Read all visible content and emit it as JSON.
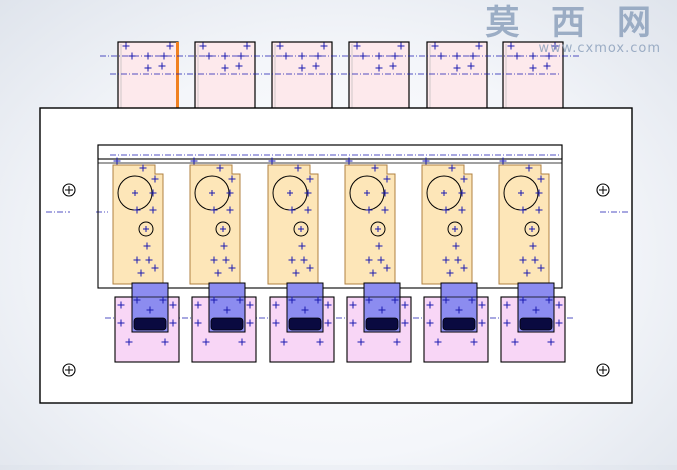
{
  "watermark": {
    "brand": "莫 西 网",
    "url": "www.cxmox.com"
  },
  "colors": {
    "plate_fill": "#ffffff",
    "outline": "#000000",
    "top_block_fill": "#fde9ec",
    "clip_fill": "#fde6b8",
    "clip_stroke": "#b08040",
    "foot_fill": "#f8d6f6",
    "blue_fill": "#8c8cf0",
    "dark_slot": "#0a0a40",
    "center_mark": "#1a1ab0",
    "accent_edge": "#f08020"
  },
  "icons": {
    "plus_mark": "plus-marker-icon",
    "hole": "circle-cross-icon"
  },
  "counts": {
    "stations": 6
  }
}
